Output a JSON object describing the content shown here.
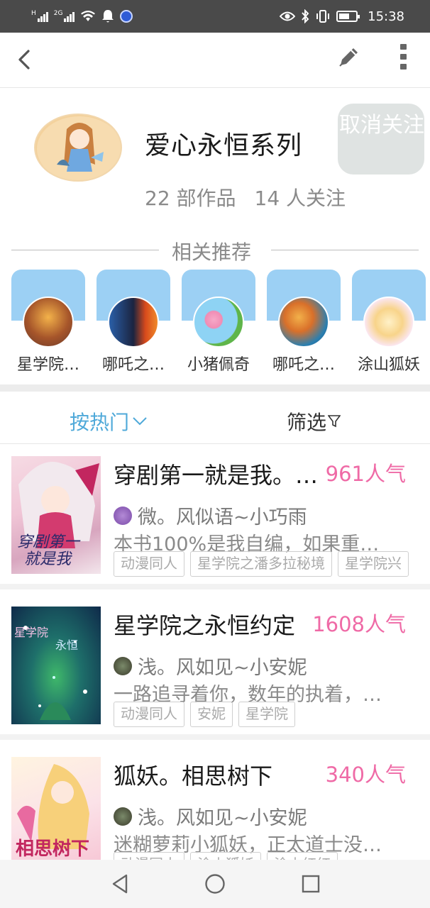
{
  "status": {
    "time": "15:38",
    "net1": "H",
    "net2": "2G"
  },
  "header": {
    "title": "爱心永恒系列",
    "unfollow": "取消关注",
    "works": "22 部作品",
    "followers": "14 人关注"
  },
  "related": {
    "heading": "相关推荐",
    "items": [
      {
        "label": "星学院…"
      },
      {
        "label": "哪吒之…"
      },
      {
        "label": "小猪佩奇"
      },
      {
        "label": "哪吒之…"
      },
      {
        "label": "涂山狐妖"
      }
    ]
  },
  "sort": {
    "hot": "按热门",
    "filter": "筛选"
  },
  "books": [
    {
      "title": "穿剧第一就是我。…",
      "popularity": "961人气",
      "author": "微。风似语~小巧雨",
      "desc": "本书100%是我自编，如果重…",
      "tags": [
        "动漫同人",
        "星学院之潘多拉秘境",
        "星学院兴"
      ],
      "cover_text": "穿剧第一就是我"
    },
    {
      "title": "星学院之永恒约定",
      "popularity": "1608人气",
      "author": "浅。风如见~小安妮",
      "desc": "一路追寻着你，数年的执着，…",
      "tags": [
        "动漫同人",
        "安妮",
        "星学院"
      ],
      "cover_text": "星学院之永恒"
    },
    {
      "title": "狐妖。相思树下",
      "popularity": "340人气",
      "author": "浅。风如见~小安妮",
      "desc": "迷糊萝莉小狐妖，正太道士没…",
      "tags": [
        "动漫同人",
        "涂山狐妖",
        "涂山红红"
      ],
      "cover_text": "相思树下"
    }
  ],
  "colors": {
    "accent_blue": "#4fa9d9",
    "popularity_pink": "#ef6aa6",
    "card_blue": "#9cd0f4",
    "unfollow_bg": "#dfe3e2"
  }
}
